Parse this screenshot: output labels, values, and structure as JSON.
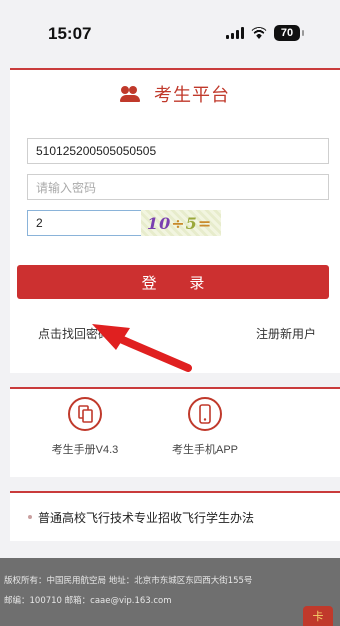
{
  "status_bar": {
    "time": "15:07",
    "battery": "70"
  },
  "header": {
    "title": "考生平台"
  },
  "form": {
    "username_value": "510125200505050505",
    "password_placeholder": "请输入密码",
    "captcha_value": "2",
    "captcha_image_text": [
      "10",
      "÷",
      "5",
      "="
    ],
    "login_button": "登 录",
    "forgot_password": "点击找回密码",
    "register": "注册新用户"
  },
  "tools": [
    {
      "label": "考生手册V4.3",
      "icon": "document-icon"
    },
    {
      "label": "考生手机APP",
      "icon": "phone-icon"
    }
  ],
  "notice": {
    "text": "普通高校飞行技术专业招收飞行学生办法"
  },
  "footer": {
    "line1": "版权所有：中国民用航空局 地址：北京市东城区东四西大街155号",
    "line2": "邮编：100710 邮箱：caae@vip.163.com",
    "badge": "卡"
  },
  "colors": {
    "brand_red": "#c0392b",
    "button_red": "#cc3030",
    "arrow_red": "#e02020"
  }
}
